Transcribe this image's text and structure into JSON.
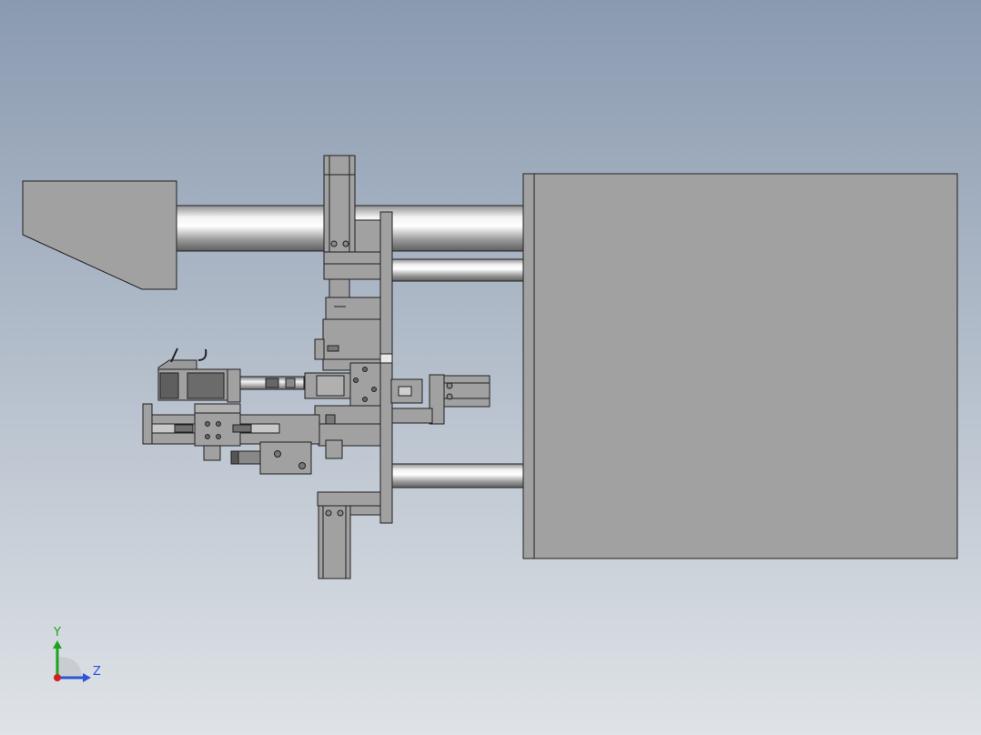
{
  "viewport": {
    "background_top": "#8a9ab0",
    "background_bottom": "#dfe3e7",
    "part_fill": "#a1a1a1",
    "part_fill_light": "#b6b6b6",
    "edge_color": "#202020"
  },
  "triad": {
    "y_label": "Y",
    "z_label": "Z",
    "y_color": "#1ea31e",
    "z_color": "#2b55d6",
    "x_color": "#d02020"
  }
}
